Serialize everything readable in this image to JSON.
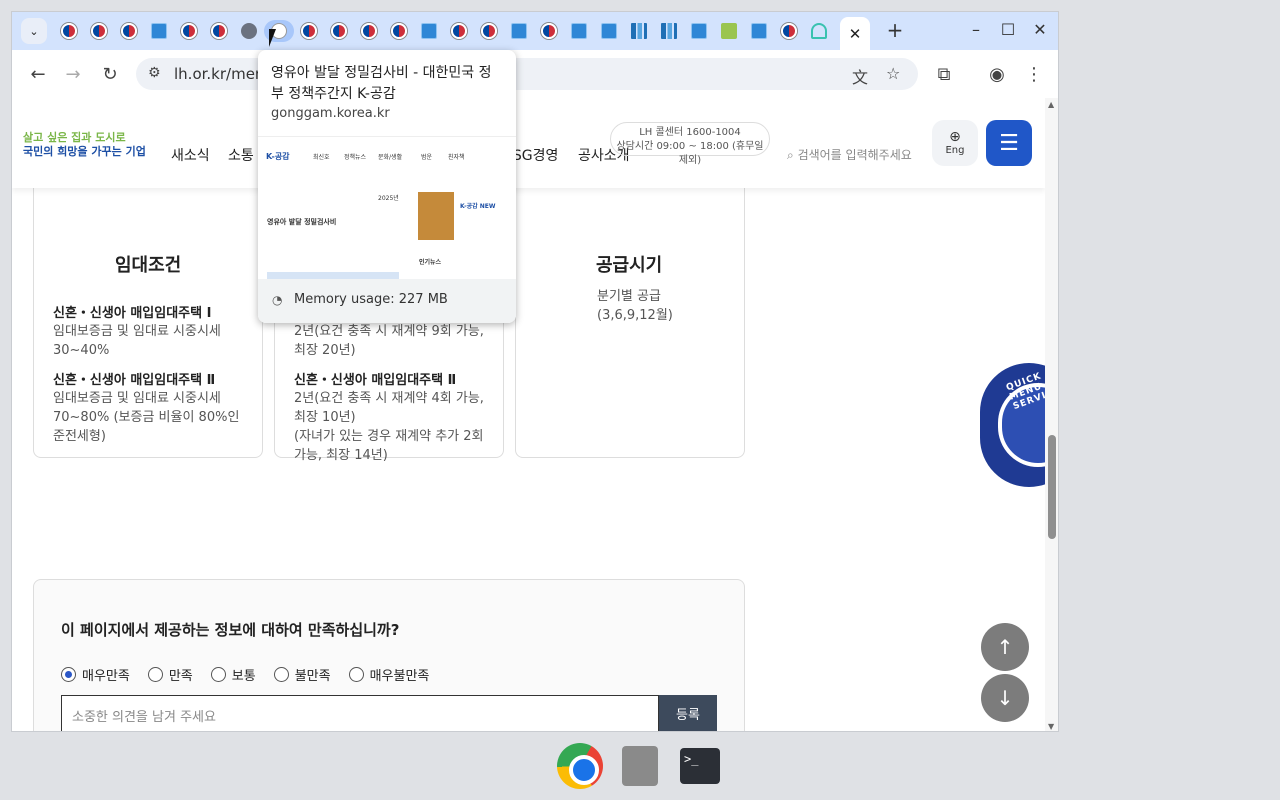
{
  "browser": {
    "url": "lh.or.kr/men",
    "active_tab_close": "✕",
    "new_tab": "+"
  },
  "tooltip": {
    "title": "영유아 발달 정밀검사비 - 대한민국 정부 정책주간지 K-공감",
    "domain": "gonggam.korea.kr",
    "memory": "Memory usage: 227 MB",
    "preview": {
      "brand": "K-공감",
      "nav": [
        "최신호",
        "정책뉴스",
        "문화/생활",
        "범운",
        "친자책"
      ],
      "headline": "영유아 발달 정밀검사비",
      "date": "2025년",
      "side_title": "K-공감 NEW",
      "popular": "인기뉴스"
    }
  },
  "site": {
    "logo_line1": "살고 싶은 집과 도시로",
    "logo_line2": "국민의 희망을 가꾸는 기업",
    "nav": [
      "새소식",
      "소통",
      "ESG경영",
      "공사소개"
    ],
    "call_line1": "LH 콜센터 1600-1004",
    "call_line2": "상담시간 09:00 ~ 18:00 (휴무일 제외)",
    "search_placeholder": "검색어를 입력해주세요",
    "eng": "Eng"
  },
  "cards": {
    "c1": {
      "title": "임대조건",
      "h1": "신혼・신생아 매입임대주택 Ⅰ",
      "t1": "임대보증금 및 임대료 시중시세 30~40%",
      "h2": "신혼・신생아 매입임대주택 Ⅱ",
      "t2": "임대보증금 및 임대료 시중시세 70~80% (보증금 비율이 80%인 준전세형)"
    },
    "c2": {
      "t0": "2년(요건 충족 시 재계약 9회 가능, 최장 20년)",
      "h2": "신혼・신생아 매입임대주택 Ⅱ",
      "t2": "2년(요건 충족 시 재계약 4회 가능, 최장 10년)",
      "t3": "(자녀가 있는 경우 재계약 추가 2회 가능, 최장 14년)"
    },
    "c3": {
      "title": "공급시기",
      "t1": "분기별 공급",
      "t2": "(3,6,9,12월)"
    }
  },
  "survey": {
    "question": "이 페이지에서 제공하는 정보에 대하여 만족하십니까?",
    "options": [
      "매우만족",
      "만족",
      "보통",
      "불만족",
      "매우불만족"
    ],
    "selected": "매우만족",
    "placeholder": "소중한 의견을 남겨 주세요",
    "submit": "등록"
  },
  "quick_menu": "QUICK MENU SERVICE",
  "icons": {
    "up": "up-arrow-icon",
    "down": "down-arrow-icon"
  }
}
